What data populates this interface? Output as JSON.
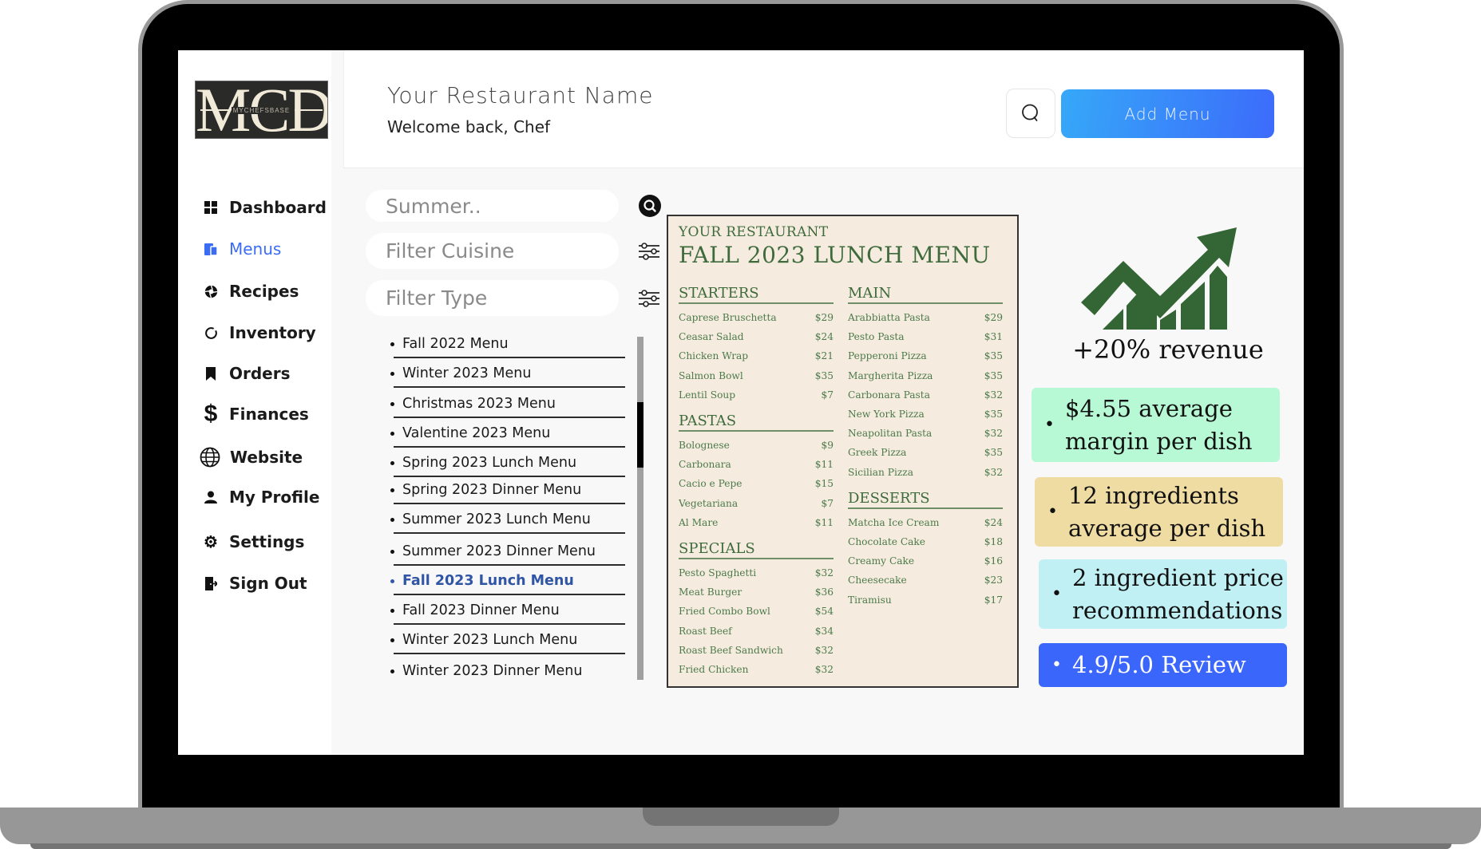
{
  "brand": {
    "logo_letters": "MCD",
    "logo_sub": "MYCHEFSBASE"
  },
  "sidebar": {
    "items": [
      {
        "label": "Dashboard",
        "icon": "grid-icon",
        "active": false
      },
      {
        "label": "Menus",
        "icon": "menu-book-icon",
        "active": true
      },
      {
        "label": "Recipes",
        "icon": "aperture-icon",
        "active": false
      },
      {
        "label": "Inventory",
        "icon": "ring-icon",
        "active": false
      },
      {
        "label": "Orders",
        "icon": "bookmark-icon",
        "active": false
      },
      {
        "label": "Finances",
        "icon": "dollar-icon",
        "active": false
      },
      {
        "label": "Website",
        "icon": "globe-icon",
        "active": false
      },
      {
        "label": "My Profile",
        "icon": "user-icon",
        "active": false
      },
      {
        "label": "Settings",
        "icon": "gear-icon",
        "active": false
      },
      {
        "label": "Sign Out",
        "icon": "sign-out-icon",
        "active": false
      }
    ]
  },
  "header": {
    "restaurant_name": "Your Restaurant Name",
    "welcome": "Welcome back, Chef",
    "add_menu_label": "Add Menu"
  },
  "filters": {
    "search_value": "",
    "search_placeholder": "Summer..",
    "cuisine_placeholder": "Filter Cuisine",
    "type_placeholder": "Filter Type"
  },
  "menu_list": {
    "items": [
      "Fall 2022 Menu",
      "Winter 2023 Menu",
      "Christmas 2023 Menu",
      "Valentine 2023 Menu",
      "Spring 2023 Lunch Menu",
      "Spring 2023 Dinner Menu",
      "Summer 2023 Lunch Menu",
      "Summer 2023 Dinner Menu",
      "Fall 2023 Lunch Menu",
      "Fall 2023 Dinner Menu",
      "Winter 2023 Lunch Menu",
      "Winter 2023 Dinner Menu"
    ],
    "active_index": 8
  },
  "menu_card": {
    "restaurant": "YOUR RESTAURANT",
    "title": "FALL 2023 LUNCH MENU",
    "left_sections": [
      {
        "heading": "STARTERS",
        "items": [
          {
            "name": "Caprese Bruschetta",
            "price": "$29"
          },
          {
            "name": "Ceasar Salad",
            "price": "$24"
          },
          {
            "name": "Chicken Wrap",
            "price": "$21"
          },
          {
            "name": "Salmon Bowl",
            "price": "$35"
          },
          {
            "name": "Lentil Soup",
            "price": "$7"
          }
        ]
      },
      {
        "heading": "PASTAS",
        "items": [
          {
            "name": "Bolognese",
            "price": "$9"
          },
          {
            "name": "Carbonara",
            "price": "$11"
          },
          {
            "name": "Cacio e Pepe",
            "price": "$15"
          },
          {
            "name": "Vegetariana",
            "price": "$7"
          },
          {
            "name": "Al Mare",
            "price": "$11"
          }
        ]
      },
      {
        "heading": "SPECIALS",
        "items": [
          {
            "name": "Pesto Spaghetti",
            "price": "$32"
          },
          {
            "name": "Meat Burger",
            "price": "$36"
          },
          {
            "name": "Fried Combo Bowl",
            "price": "$54"
          },
          {
            "name": "Roast Beef",
            "price": "$34"
          },
          {
            "name": "Roast Beef Sandwich",
            "price": "$32"
          },
          {
            "name": "Fried Chicken",
            "price": "$32"
          }
        ]
      }
    ],
    "right_sections": [
      {
        "heading": "MAIN",
        "items": [
          {
            "name": "Arabbiatta Pasta",
            "price": "$29"
          },
          {
            "name": "Pesto Pasta",
            "price": "$31"
          },
          {
            "name": "Pepperoni Pizza",
            "price": "$35"
          },
          {
            "name": "Margherita Pizza",
            "price": "$35"
          },
          {
            "name": "Carbonara Pasta",
            "price": "$32"
          },
          {
            "name": "New York Pizza",
            "price": "$35"
          },
          {
            "name": "Neapolitan Pasta",
            "price": "$32"
          },
          {
            "name": "Greek Pizza",
            "price": "$35"
          },
          {
            "name": "Sicilian Pizza",
            "price": "$32"
          }
        ]
      },
      {
        "heading": "DESSERTS",
        "items": [
          {
            "name": "Matcha Ice Cream",
            "price": "$24"
          },
          {
            "name": "Chocolate Cake",
            "price": "$18"
          },
          {
            "name": "Creamy Cake",
            "price": "$16"
          },
          {
            "name": "Cheesecake",
            "price": "$23"
          },
          {
            "name": "Tiramisu",
            "price": "$17"
          }
        ]
      }
    ]
  },
  "stats": {
    "revenue": "+20% revenue",
    "cards": [
      {
        "text": "$4.55 average margin per dish",
        "color": "#b6f9d4"
      },
      {
        "text": "12 ingredients average per dish",
        "color": "#efdca3"
      },
      {
        "text": "2 ingredient price recommendations",
        "color": "#c0f0f4"
      },
      {
        "text": "4.9/5.0 Review",
        "color": "#3b66fb"
      }
    ]
  },
  "colors": {
    "accent": "#3b6cf6",
    "menu_green": "#3f6b3c",
    "chart_green": "#336634"
  }
}
